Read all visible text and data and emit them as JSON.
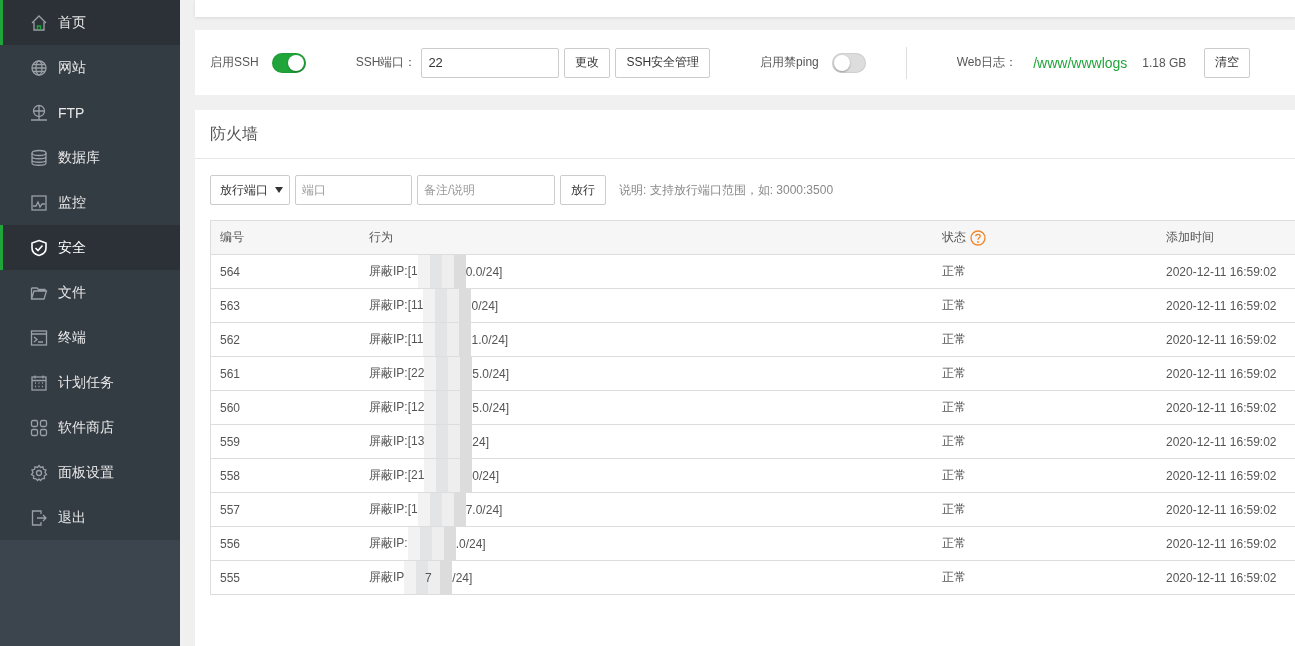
{
  "sidebar": {
    "items": [
      {
        "label": "首页",
        "selected": false,
        "marked": true
      },
      {
        "label": "网站",
        "selected": false,
        "marked": false
      },
      {
        "label": "FTP",
        "selected": false,
        "marked": false
      },
      {
        "label": "数据库",
        "selected": false,
        "marked": false
      },
      {
        "label": "监控",
        "selected": false,
        "marked": false
      },
      {
        "label": "安全",
        "selected": true,
        "marked": true
      },
      {
        "label": "文件",
        "selected": false,
        "marked": false
      },
      {
        "label": "终端",
        "selected": false,
        "marked": false
      },
      {
        "label": "计划任务",
        "selected": false,
        "marked": false
      },
      {
        "label": "软件商店",
        "selected": false,
        "marked": false
      },
      {
        "label": "面板设置",
        "selected": false,
        "marked": false
      },
      {
        "label": "退出",
        "selected": false,
        "marked": false
      }
    ]
  },
  "settings": {
    "ssh_label": "启用SSH",
    "ssh_on": true,
    "port_label": "SSH端口：",
    "port_value": "22",
    "change_button": "更改",
    "ssh_manage_button": "SSH安全管理",
    "ping_label": "启用禁ping",
    "ping_on": false,
    "weblog_label": "Web日志：",
    "weblog_path": "/www/wwwlogs",
    "weblog_size": "1.18 GB",
    "clear_button": "清空"
  },
  "firewall": {
    "title": "防火墙",
    "rule_select": "放行端口",
    "port_placeholder": "端口",
    "note_placeholder": "备注/说明",
    "allow_button": "放行",
    "hint": "说明: 支持放行端口范围，如: 3000:3500",
    "columns": [
      "编号",
      "行为",
      "状态",
      "添加时间"
    ],
    "rows": [
      {
        "id": "564",
        "action_before": "屏蔽IP:[1",
        "action_after": "0.0/24]",
        "status": "正常",
        "time": "2020-12-11 16:59:02"
      },
      {
        "id": "563",
        "action_before": "屏蔽IP:[11",
        "action_after": "0/24]",
        "status": "正常",
        "time": "2020-12-11 16:59:02"
      },
      {
        "id": "562",
        "action_before": "屏蔽IP:[11",
        "action_after": "1.0/24]",
        "status": "正常",
        "time": "2020-12-11 16:59:02"
      },
      {
        "id": "561",
        "action_before": "屏蔽IP:[22",
        "action_after": "5.0/24]",
        "status": "正常",
        "time": "2020-12-11 16:59:02"
      },
      {
        "id": "560",
        "action_before": "屏蔽IP:[12",
        "action_after": "5.0/24]",
        "status": "正常",
        "time": "2020-12-11 16:59:02"
      },
      {
        "id": "559",
        "action_before": "屏蔽IP:[13",
        "action_after": "24]",
        "status": "正常",
        "time": "2020-12-11 16:59:02"
      },
      {
        "id": "558",
        "action_before": "屏蔽IP:[21",
        "action_after": "0/24]",
        "status": "正常",
        "time": "2020-12-11 16:59:02"
      },
      {
        "id": "557",
        "action_before": "屏蔽IP:[1",
        "action_after": "7.0/24]",
        "status": "正常",
        "time": "2020-12-11 16:59:02"
      },
      {
        "id": "556",
        "action_before": "屏蔽IP:",
        "action_after": ".0/24]",
        "status": "正常",
        "time": "2020-12-11 16:59:02"
      },
      {
        "id": "555",
        "action_before": "屏蔽IP",
        "action_middle": "7",
        "action_after": "/24]",
        "status": "正常",
        "time": "2020-12-11 16:59:02"
      }
    ]
  }
}
